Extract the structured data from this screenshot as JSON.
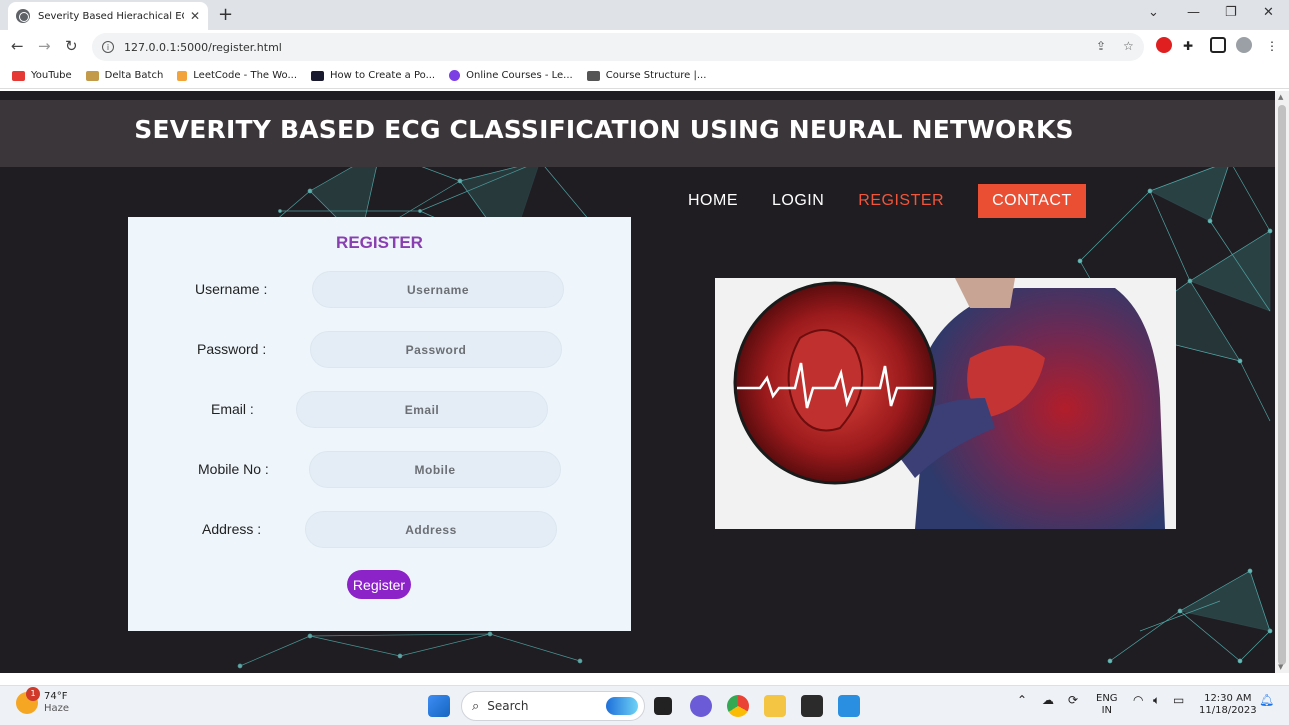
{
  "browser": {
    "tab_title": "Severity Based Hierachical ECAG",
    "url": "127.0.0.1:5000/register.html",
    "bookmarks": [
      {
        "label": "YouTube",
        "color": "#e53935"
      },
      {
        "label": "Delta Batch",
        "color": "#9c7a3c"
      },
      {
        "label": "LeetCode - The Wo...",
        "color": "#222222"
      },
      {
        "label": "How to Create a Po...",
        "color": "#1a1a2e"
      },
      {
        "label": "Online Courses - Le...",
        "color": "#7b3fe4"
      },
      {
        "label": "Course Structure |...",
        "color": "#444444"
      }
    ]
  },
  "site": {
    "title": "SEVERITY BASED ECG CLASSIFICATION USING NEURAL NETWORKS",
    "nav": {
      "home": "HOME",
      "login": "LOGIN",
      "register": "REGISTER",
      "contact": "CONTACT"
    },
    "accent": "#ea4f34"
  },
  "form": {
    "title": "REGISTER",
    "fields": {
      "username": {
        "label": "Username :",
        "placeholder": "Username"
      },
      "password": {
        "label": "Password :",
        "placeholder": "Password"
      },
      "email": {
        "label": "Email :",
        "placeholder": "Email"
      },
      "mobile": {
        "label": "Mobile No :",
        "placeholder": "Mobile"
      },
      "address": {
        "label": "Address :",
        "placeholder": "Address"
      }
    },
    "submit_label": "Register",
    "button_color": "#8c23c9"
  },
  "taskbar": {
    "temperature": "74°F",
    "condition": "Haze",
    "weather_badge": "1",
    "search_placeholder": "Search",
    "lang_top": "ENG",
    "lang_bottom": "IN",
    "time": "12:30 AM",
    "date": "11/18/2023"
  }
}
